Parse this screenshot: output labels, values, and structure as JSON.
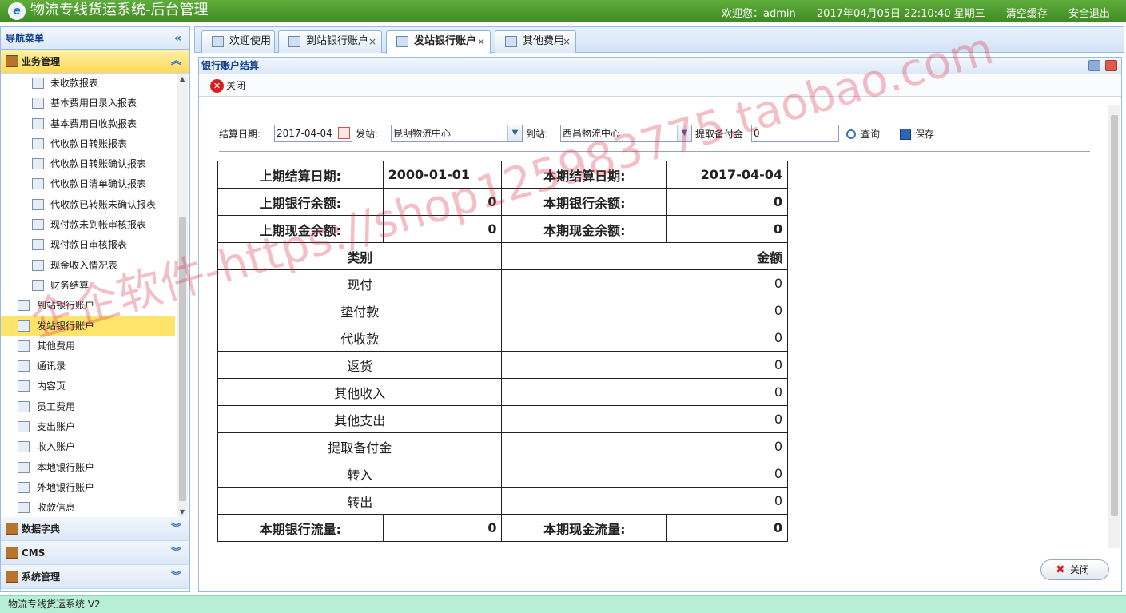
{
  "header": {
    "title": "物流专线货运系统-后台管理",
    "welcome": "欢迎您：admin",
    "datetime": "2017年04月05日 22:10:40 星期三",
    "clear_cache": "清空缓存",
    "logout": "安全退出"
  },
  "sidebar": {
    "title": "导航菜单",
    "active_group": "业务管理",
    "sub_items": [
      "未收款报表",
      "基本费用日录入报表",
      "基本费用日收款报表",
      "代收款日转账报表",
      "代收款日转账确认报表",
      "代收款日清单确认报表",
      "代收款已转账未确认报表",
      "现付款未到帐审核报表",
      "现付款日审核报表",
      "现金收入情况表",
      "财务结算"
    ],
    "top_items": [
      "到站银行账户",
      "发站银行账户",
      "其他费用",
      "通讯录",
      "内容页",
      "员工费用",
      "支出账户",
      "收入账户",
      "本地银行账户",
      "外地银行账户",
      "收款信息"
    ],
    "selected_item": "发站银行账户",
    "groups": [
      "数据字典",
      "CMS",
      "系统管理"
    ]
  },
  "tabs": [
    {
      "label": "欢迎使用"
    },
    {
      "label": "到站银行账户"
    },
    {
      "label": "发站银行账户"
    },
    {
      "label": "其他费用"
    }
  ],
  "panel": {
    "title": "银行账户结算",
    "close_label": "关闭"
  },
  "form": {
    "date_label": "结算日期:",
    "date_value": "2017-04-04",
    "from_label": "发站:",
    "from_value": "昆明物流中心",
    "to_label": "到站:",
    "to_value": "西昌物流中心",
    "reserve_label": "提取备付金",
    "reserve_value": "0",
    "query_label": "查询",
    "save_label": "保存"
  },
  "table": {
    "prev_date_label": "上期结算日期:",
    "prev_date": "2000-01-01",
    "cur_date_label": "本期结算日期:",
    "cur_date": "2017-04-04",
    "prev_bank_label": "上期银行余额:",
    "prev_bank": "0",
    "cur_bank_label": "本期银行余额:",
    "cur_bank": "0",
    "prev_cash_label": "上期现金余额:",
    "prev_cash": "0",
    "cur_cash_label": "本期现金余额:",
    "cur_cash": "0",
    "category_header": "类别",
    "amount_header": "金额",
    "rows": [
      {
        "category": "现付",
        "amount": "0"
      },
      {
        "category": "垫付款",
        "amount": "0"
      },
      {
        "category": "代收款",
        "amount": "0"
      },
      {
        "category": "返货",
        "amount": "0"
      },
      {
        "category": "其他收入",
        "amount": "0"
      },
      {
        "category": "其他支出",
        "amount": "0"
      },
      {
        "category": "提取备付金",
        "amount": "0"
      },
      {
        "category": "转入",
        "amount": "0"
      },
      {
        "category": "转出",
        "amount": "0"
      }
    ],
    "bank_flow_label": "本期银行流量:",
    "bank_flow": "0",
    "cash_flow_label": "本期现金流量:",
    "cash_flow": "0"
  },
  "footer_close": "关闭",
  "watermark": "企企软件-https://shop125983775.taobao.com",
  "statusbar": "物流专线货运系统 V2"
}
